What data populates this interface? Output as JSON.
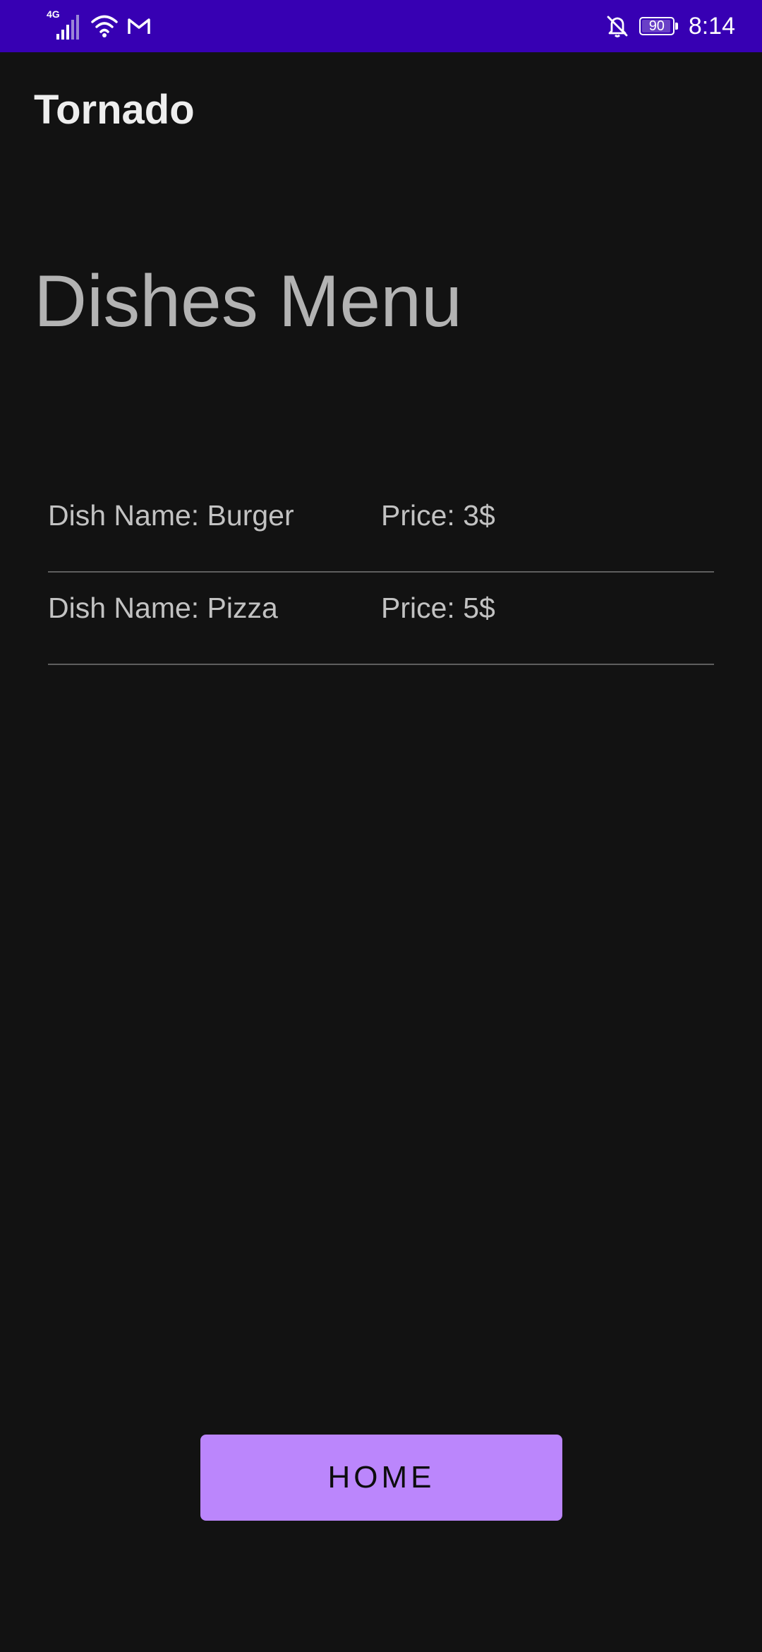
{
  "status_bar": {
    "network_type": "4G",
    "time": "8:14",
    "battery_level": "90",
    "icons": [
      "signal-icon",
      "wifi-icon",
      "gmail-icon",
      "bell-off-icon",
      "battery-icon"
    ],
    "background_color": "#3700b3"
  },
  "app_bar": {
    "title": "Tornado"
  },
  "main": {
    "heading": "Dishes Menu",
    "dishes": [
      {
        "name": "Dish Name: Burger",
        "price": "Price: 3$"
      },
      {
        "name": "Dish Name: Pizza",
        "price": "Price: 5$"
      }
    ],
    "home_button_label": "HOME"
  },
  "colors": {
    "background": "#121212",
    "accent": "#bb86fc",
    "divider": "#5e5e5e"
  }
}
